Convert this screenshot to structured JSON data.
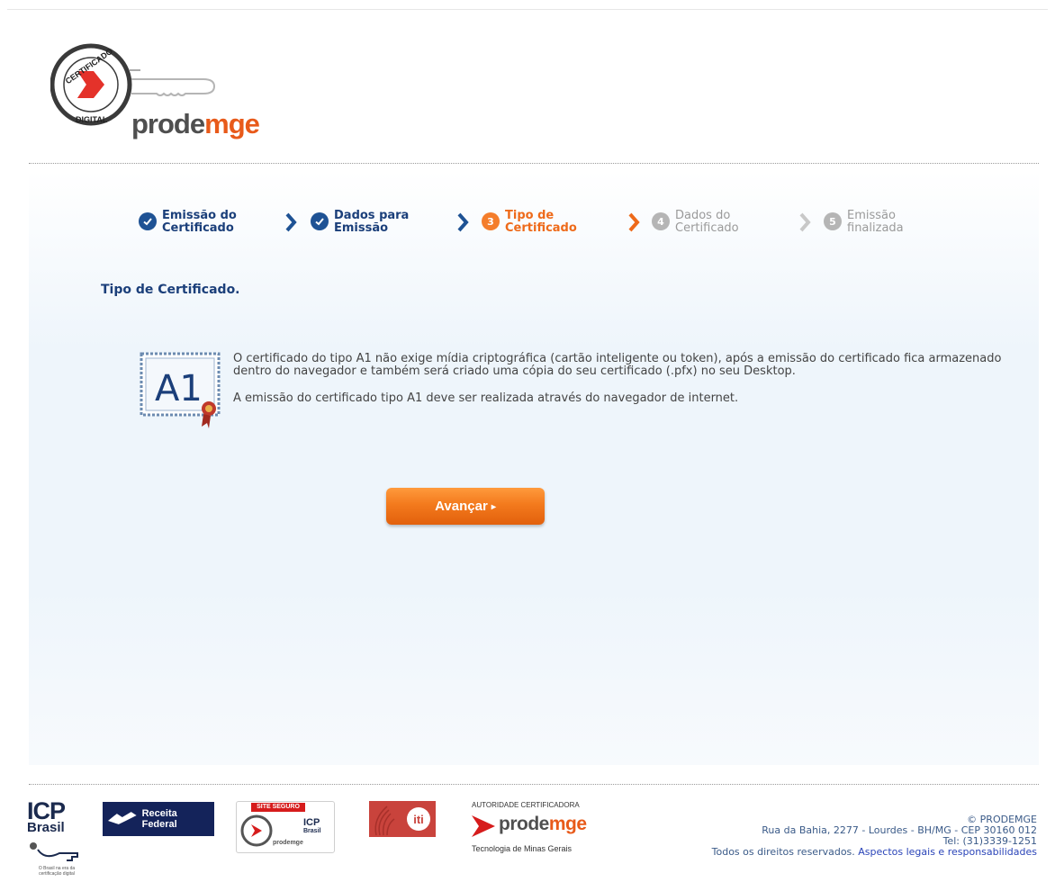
{
  "header": {
    "seal_text_top": "CERTIFICADO",
    "seal_text_bottom": "DIGITAL",
    "brand_prefix": "prode",
    "brand_suffix": "mge"
  },
  "steps": [
    {
      "line1": "Emissão do",
      "line2": "Certificado",
      "state": "done"
    },
    {
      "line1": "Dados para",
      "line2": "Emissão",
      "state": "done"
    },
    {
      "number": "3",
      "line1": "Tipo de",
      "line2": "Certificado",
      "state": "active"
    },
    {
      "number": "4",
      "line1": "Dados do",
      "line2": "Certificado",
      "state": "pending"
    },
    {
      "number": "5",
      "line1": "Emissão",
      "line2": "finalizada",
      "state": "pending"
    }
  ],
  "page_title": "Tipo de Certificado.",
  "certificate": {
    "type_label": "A1",
    "paragraph1": "O certificado do tipo A1 não exige mídia criptográfica (cartão inteligente ou token), após a emissão do certificado fica armazenado dentro do navegador e também será criado uma cópia do seu certificado (.pfx) no seu Desktop.",
    "paragraph2": "A emissão do certificado tipo A1 deve ser realizada através do navegador de internet."
  },
  "next_button": {
    "label": "Avançar",
    "arrow": "▸"
  },
  "footer": {
    "icp_line1": "ICP",
    "icp_line2": "Brasil",
    "icp_tag": "O Brasil na era da certificação digital",
    "receita_label": "Receita Federal",
    "site_seguro_label": "SITE SEGURO",
    "site_seguro_icp": "ICP",
    "site_seguro_brasil": "Brasil",
    "site_seguro_brand": "prodemge",
    "iti_label": "iti",
    "ac_label": "AUTORIDADE CERTIFICADORA",
    "ac_brand_prefix": "prode",
    "ac_brand_suffix": "mge",
    "ac_tagline": "Tecnologia de Minas Gerais",
    "copyright": "© PRODEMGE",
    "address": "Rua da Bahia, 2277 - Lourdes - BH/MG - CEP 30160 012",
    "phone": "Tel: (31)3339-1251",
    "rights": "Todos os direitos reservados.",
    "legal_link": "Aspectos legais e responsabilidades"
  },
  "colors": {
    "brand_navy": "#1b3f7a",
    "brand_orange": "#ee6a1a",
    "pending_gray": "#9a9a9a",
    "link_blue": "#2a44b8"
  }
}
